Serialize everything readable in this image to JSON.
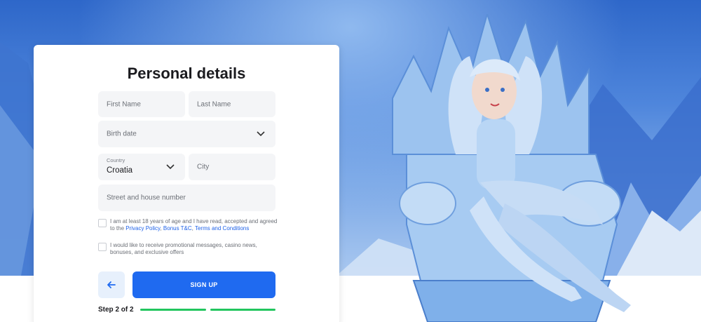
{
  "form": {
    "title": "Personal details",
    "first_name_placeholder": "First Name",
    "last_name_placeholder": "Last Name",
    "birth_date_placeholder": "Birth date",
    "country_label": "Country",
    "country_value": "Croatia",
    "city_placeholder": "City",
    "street_placeholder": "Street and house number",
    "terms_text_prefix": "I am at least 18 years of age and I have read, accepted and agreed to the ",
    "privacy_link": "Privacy Policy",
    "bonus_link": "Bonus T&C",
    "terms_link": "Terms and Conditions",
    "promo_text": "I would like to receive promotional messages, casino news, bonuses, and exclusive offers",
    "signup_label": "SIGN UP",
    "step_label": "Step 2 of 2",
    "steps_total": 2,
    "steps_completed": 2
  },
  "colors": {
    "accent": "#1f6af0",
    "progress": "#22c55e",
    "link": "#1f62e8"
  },
  "icons": {
    "back": "arrow-left-icon",
    "dropdown": "chevron-down-icon"
  }
}
